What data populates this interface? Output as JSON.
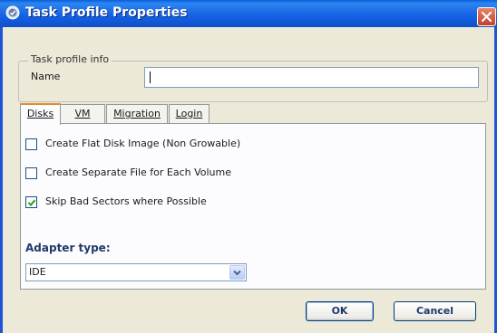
{
  "window": {
    "title": "Task Profile Properties",
    "icon": "gear-icon",
    "close_icon": "close-icon"
  },
  "task_profile_info": {
    "legend": "Task profile info",
    "name_label": "Name",
    "name_value": ""
  },
  "tabs": [
    {
      "label": "Disks",
      "active": true
    },
    {
      "label": "VM",
      "active": false
    },
    {
      "label": "Migration",
      "active": false
    },
    {
      "label": "Login",
      "active": false
    }
  ],
  "disks": {
    "options": [
      {
        "label": "Create Flat Disk Image (Non Growable)",
        "checked": false
      },
      {
        "label": "Create Separate File for Each Volume",
        "checked": false
      },
      {
        "label": "Skip Bad Sectors where Possible",
        "checked": true
      }
    ],
    "adapter_label": "Adapter type:",
    "adapter_value": "IDE"
  },
  "buttons": {
    "ok": "OK",
    "cancel": "Cancel"
  },
  "colors": {
    "titlebar": "#1664e6",
    "active_tab_highlight": "#e68b2c",
    "checkmark": "#21a121"
  }
}
